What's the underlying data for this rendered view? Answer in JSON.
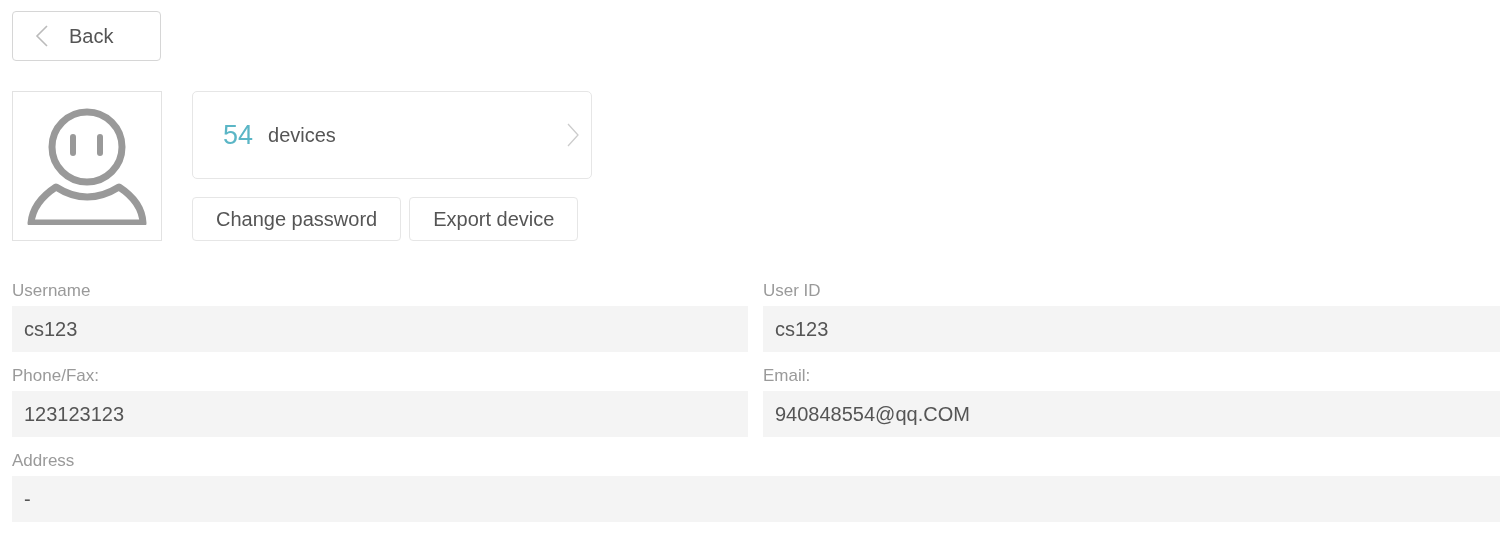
{
  "back_button": {
    "label": "Back"
  },
  "devices_card": {
    "count": "54",
    "label": "devices"
  },
  "actions": [
    "Change password",
    "Export device"
  ],
  "fields": [
    {
      "label": "Username",
      "value": "cs123",
      "kind": "half"
    },
    {
      "label": "User ID",
      "value": "cs123",
      "kind": "half"
    },
    {
      "label": "Phone/Fax:",
      "value": "123123123",
      "kind": "half"
    },
    {
      "label": "Email:",
      "value": "940848554@qq.COM",
      "kind": "half"
    },
    {
      "label": "Address",
      "value": "-",
      "kind": "full"
    }
  ]
}
